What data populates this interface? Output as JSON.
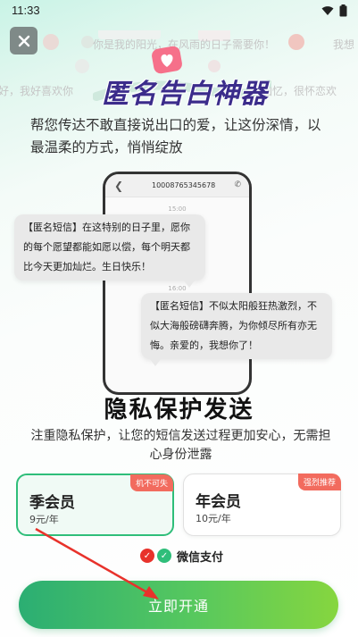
{
  "status_bar": {
    "time": "11:33"
  },
  "marquee": {
    "line1": "你是我的阳光，在风雨的日子需要你！",
    "line1_tail": "我想",
    "line2": "好，我好喜欢你",
    "line2_tail": "回忆，很怀恋欢"
  },
  "banner": {
    "title": "匿名告白神器"
  },
  "subtitle": "帮您传达不敢直接说出口的爱，让这份深情，以最温柔的方式，悄悄绽放",
  "phone": {
    "number": "10008765345678",
    "time1": "15:00",
    "time2": "16:00"
  },
  "messages": [
    {
      "text": "【匿名短信】在这特别的日子里，愿你的每个愿望都能如愿以偿，每个明天都比今天更加灿烂。生日快乐！"
    },
    {
      "text": "【匿名短信】不似太阳般狂热激烈，不似大海般磅礴奔腾，为你倾尽所有亦无悔。亲爱的，我想你了！"
    }
  ],
  "section": {
    "title": "隐私保护发送",
    "desc": "注重隐私保护，让您的短信发送过程更加安心，无需担心身份泄露"
  },
  "plans": [
    {
      "name": "季会员",
      "price": "9元/年",
      "tag": "机不可失",
      "selected": true
    },
    {
      "name": "年会员",
      "price": "10元/年",
      "tag": "强烈推荐",
      "selected": false
    }
  ],
  "payment": {
    "label": "微信支付"
  },
  "cta": {
    "label": "立即开通"
  },
  "colors": {
    "accent_green": "#2fbe7a",
    "tag_red": "#f26b5e",
    "title_purple": "#3b2c8b",
    "annotation_red": "#e8322b"
  }
}
